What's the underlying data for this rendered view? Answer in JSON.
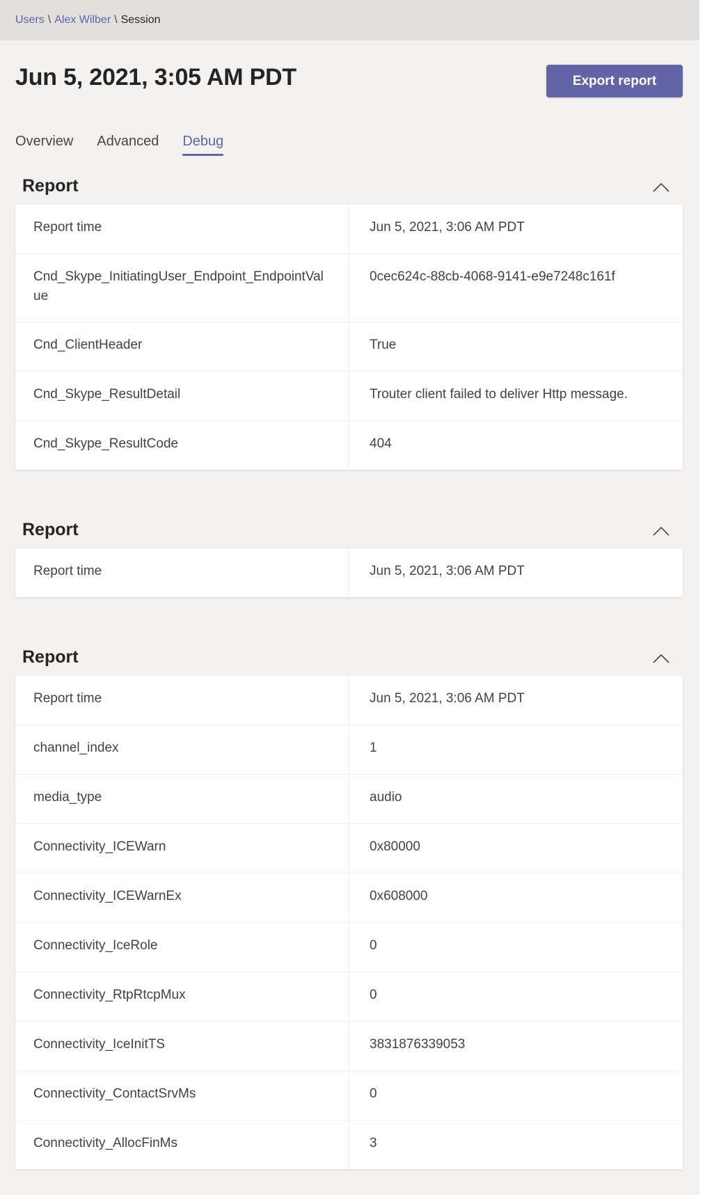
{
  "breadcrumb": {
    "items": [
      "Users",
      "Alex Wilber",
      "Session"
    ],
    "separator": "\\"
  },
  "header": {
    "title": "Jun 5, 2021, 3:05 AM PDT",
    "export_label": "Export report"
  },
  "tabs": [
    {
      "label": "Overview",
      "active": false
    },
    {
      "label": "Advanced",
      "active": false
    },
    {
      "label": "Debug",
      "active": true
    }
  ],
  "colors": {
    "accent": "#6264a7",
    "background": "#f3f2f1",
    "breadcrumb_bar": "#e1e0df"
  },
  "sections": [
    {
      "title": "Report",
      "icon": "chevron-up-icon",
      "rows": [
        {
          "key": "Report time",
          "value": "Jun 5, 2021, 3:06 AM PDT"
        },
        {
          "key": "Cnd_Skype_InitiatingUser_Endpoint_EndpointValue",
          "value": "0cec624c-88cb-4068-9141-e9e7248c161f"
        },
        {
          "key": "Cnd_ClientHeader",
          "value": "True"
        },
        {
          "key": "Cnd_Skype_ResultDetail",
          "value": "Trouter client failed to deliver Http message."
        },
        {
          "key": "Cnd_Skype_ResultCode",
          "value": "404"
        }
      ]
    },
    {
      "title": "Report",
      "icon": "chevron-up-icon",
      "rows": [
        {
          "key": "Report time",
          "value": "Jun 5, 2021, 3:06 AM PDT"
        }
      ]
    },
    {
      "title": "Report",
      "icon": "chevron-up-icon",
      "rows": [
        {
          "key": "Report time",
          "value": "Jun 5, 2021, 3:06 AM PDT"
        },
        {
          "key": "channel_index",
          "value": "1"
        },
        {
          "key": "media_type",
          "value": "audio"
        },
        {
          "key": "Connectivity_ICEWarn",
          "value": "0x80000"
        },
        {
          "key": "Connectivity_ICEWarnEx",
          "value": "0x608000"
        },
        {
          "key": "Connectivity_IceRole",
          "value": "0"
        },
        {
          "key": "Connectivity_RtpRtcpMux",
          "value": "0"
        },
        {
          "key": "Connectivity_IceInitTS",
          "value": "3831876339053"
        },
        {
          "key": "Connectivity_ContactSrvMs",
          "value": "0"
        },
        {
          "key": "Connectivity_AllocFinMs",
          "value": "3"
        }
      ]
    }
  ]
}
